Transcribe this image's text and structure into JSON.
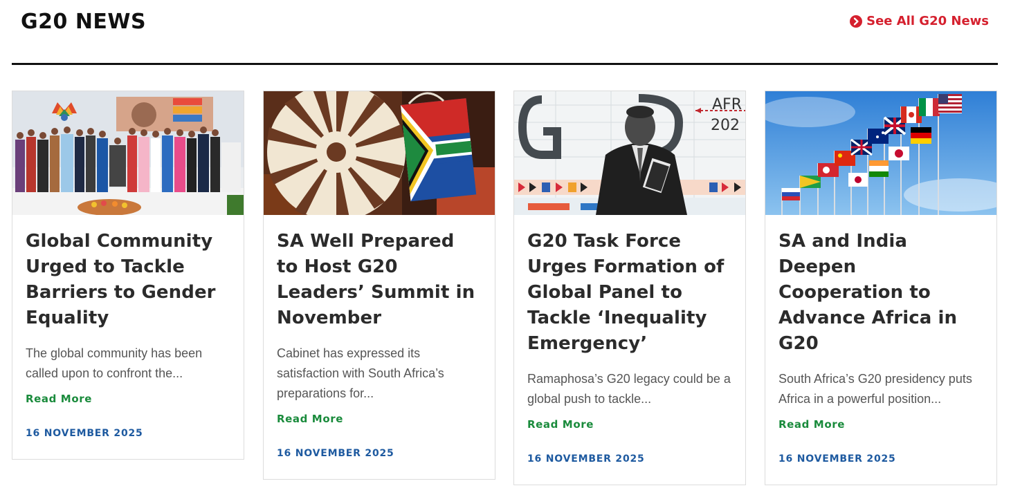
{
  "header": {
    "title": "G20 NEWS",
    "see_all_label": "See All G20 News",
    "see_all_icon": "chevron-circle-right-icon",
    "accent_color": "#d5202e"
  },
  "articles": [
    {
      "image": "women-leaders-group-photo",
      "title": "Global Community Urged to Tackle Barriers to Gender Equality",
      "excerpt": "The global community has been called upon to confront the...",
      "read_more": "Read More",
      "date": "16 NOVEMBER 2025"
    },
    {
      "image": "woven-basket-and-sa-flag-bag",
      "title": "SA Well Prepared to Host G20 Leaders’ Summit in November",
      "excerpt": "Cabinet has expressed its satisfaction with South Africa’s preparations for...",
      "read_more": "Read More",
      "date": "16 NOVEMBER 2025"
    },
    {
      "image": "ramaphosa-g20-africa-backdrop",
      "title": "G20 Task Force Urges Formation of Global Panel to Tackle ‘Inequality Emergency’",
      "excerpt": "Ramaphosa’s G20 legacy could be a global push to tackle...",
      "read_more": "Read More",
      "date": "16 NOVEMBER 2025"
    },
    {
      "image": "g20-national-flags",
      "title": "SA and India Deepen Cooperation to Advance Africa in G20",
      "excerpt": "South Africa’s G20 presidency puts Africa in a powerful position...",
      "read_more": "Read More",
      "date": "16 NOVEMBER 2025"
    }
  ],
  "colors": {
    "read_more": "#1a8b3c",
    "date": "#1e5aa0",
    "title": "#2b2b2b"
  }
}
